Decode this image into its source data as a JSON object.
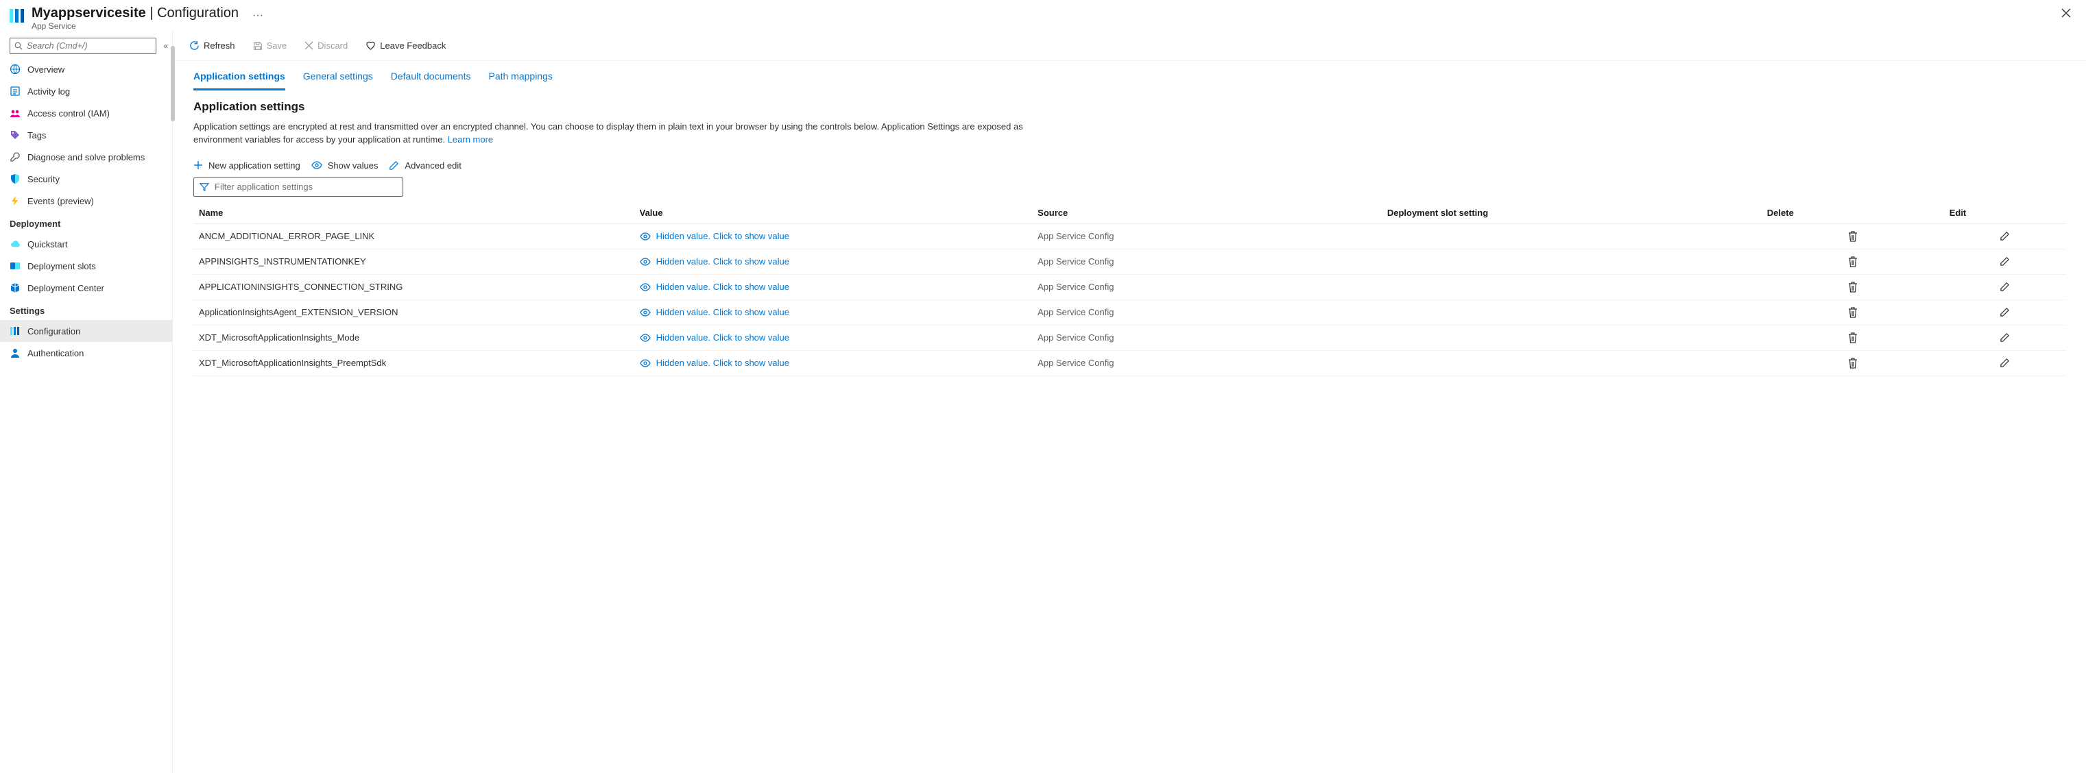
{
  "header": {
    "title_strong": "Myappservicesite",
    "title_rest": "Configuration",
    "subtitle": "App Service"
  },
  "sidebar": {
    "search_placeholder": "Search (Cmd+/)",
    "items_top": [
      {
        "label": "Overview",
        "icon": "globe"
      },
      {
        "label": "Activity log",
        "icon": "log"
      },
      {
        "label": "Access control (IAM)",
        "icon": "people"
      },
      {
        "label": "Tags",
        "icon": "tag"
      },
      {
        "label": "Diagnose and solve problems",
        "icon": "wrench"
      },
      {
        "label": "Security",
        "icon": "shield"
      },
      {
        "label": "Events (preview)",
        "icon": "bolt"
      }
    ],
    "group_deployment": "Deployment",
    "items_deployment": [
      {
        "label": "Quickstart",
        "icon": "cloud"
      },
      {
        "label": "Deployment slots",
        "icon": "slots"
      },
      {
        "label": "Deployment Center",
        "icon": "cube"
      }
    ],
    "group_settings": "Settings",
    "items_settings": [
      {
        "label": "Configuration",
        "icon": "bars",
        "selected": true
      },
      {
        "label": "Authentication",
        "icon": "person"
      }
    ]
  },
  "toolbar": {
    "refresh": "Refresh",
    "save": "Save",
    "discard": "Discard",
    "feedback": "Leave Feedback"
  },
  "tabs": [
    {
      "label": "Application settings",
      "active": true
    },
    {
      "label": "General settings"
    },
    {
      "label": "Default documents"
    },
    {
      "label": "Path mappings"
    }
  ],
  "section": {
    "title": "Application settings",
    "desc_a": "Application settings are encrypted at rest and transmitted over an encrypted channel. You can choose to display them in plain text in your browser by using the controls below. Application Settings are exposed as environment variables for access by your application at runtime. ",
    "learn_more": "Learn more"
  },
  "actions": {
    "new_setting": "New application setting",
    "show_values": "Show values",
    "advanced_edit": "Advanced edit"
  },
  "filter": {
    "placeholder": "Filter application settings"
  },
  "table": {
    "headers": {
      "name": "Name",
      "value": "Value",
      "source": "Source",
      "slot": "Deployment slot setting",
      "delete": "Delete",
      "edit": "Edit"
    },
    "hidden_text": "Hidden value. Click to show value",
    "rows": [
      {
        "name": "ANCM_ADDITIONAL_ERROR_PAGE_LINK",
        "source": "App Service Config"
      },
      {
        "name": "APPINSIGHTS_INSTRUMENTATIONKEY",
        "source": "App Service Config"
      },
      {
        "name": "APPLICATIONINSIGHTS_CONNECTION_STRING",
        "source": "App Service Config"
      },
      {
        "name": "ApplicationInsightsAgent_EXTENSION_VERSION",
        "source": "App Service Config"
      },
      {
        "name": "XDT_MicrosoftApplicationInsights_Mode",
        "source": "App Service Config"
      },
      {
        "name": "XDT_MicrosoftApplicationInsights_PreemptSdk",
        "source": "App Service Config"
      }
    ]
  }
}
